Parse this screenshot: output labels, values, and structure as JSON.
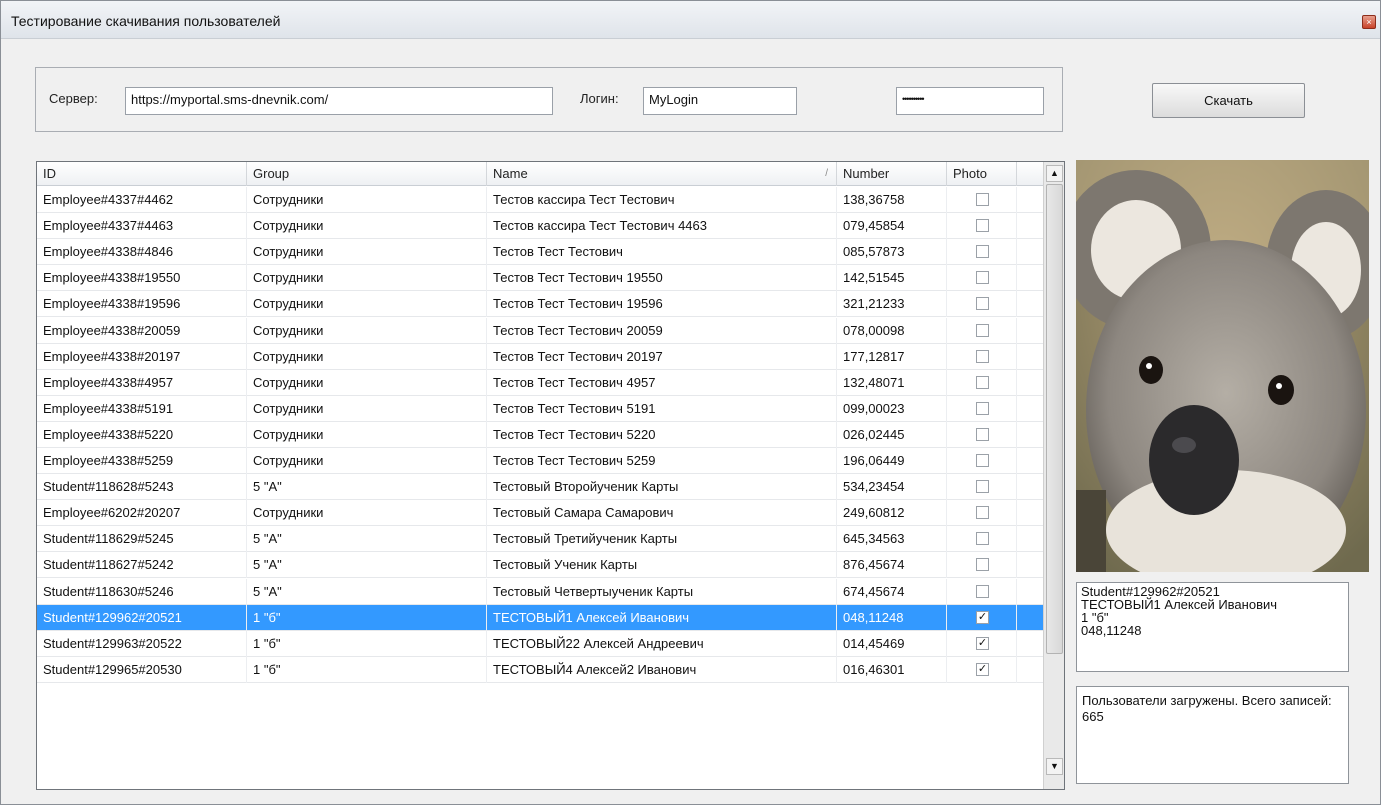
{
  "window": {
    "title": "Тестирование скачивания пользователей",
    "close_glyph": "×"
  },
  "connection": {
    "server_label": "Сервер:",
    "server_value": "https://myportal.sms-dnevnik.com/",
    "login_label": "Логин:",
    "login_value": "MyLogin",
    "password_value": "••••••••••"
  },
  "download_button": "Скачать",
  "grid": {
    "columns": [
      "ID",
      "Group",
      "Name",
      "Number",
      "Photo"
    ],
    "sort_column": "Name",
    "sort_glyph": "/",
    "rows": [
      {
        "id": "Employee#4337#4462",
        "group": "Сотрудники",
        "name": "Тестов кассира Тест Тестович",
        "number": "138,36758",
        "photo": false
      },
      {
        "id": "Employee#4337#4463",
        "group": "Сотрудники",
        "name": "Тестов кассира Тест Тестович 4463",
        "number": "079,45854",
        "photo": false
      },
      {
        "id": "Employee#4338#4846",
        "group": "Сотрудники",
        "name": "Тестов Тест Тестович",
        "number": "085,57873",
        "photo": false
      },
      {
        "id": "Employee#4338#19550",
        "group": "Сотрудники",
        "name": "Тестов Тест Тестович 19550",
        "number": "142,51545",
        "photo": false
      },
      {
        "id": "Employee#4338#19596",
        "group": "Сотрудники",
        "name": "Тестов Тест Тестович 19596",
        "number": "321,21233",
        "photo": false
      },
      {
        "id": "Employee#4338#20059",
        "group": "Сотрудники",
        "name": "Тестов Тест Тестович 20059",
        "number": "078,00098",
        "photo": false
      },
      {
        "id": "Employee#4338#20197",
        "group": "Сотрудники",
        "name": "Тестов Тест Тестович 20197",
        "number": "177,12817",
        "photo": false
      },
      {
        "id": "Employee#4338#4957",
        "group": "Сотрудники",
        "name": "Тестов Тест Тестович 4957",
        "number": "132,48071",
        "photo": false
      },
      {
        "id": "Employee#4338#5191",
        "group": "Сотрудники",
        "name": "Тестов Тест Тестович 5191",
        "number": "099,00023",
        "photo": false
      },
      {
        "id": "Employee#4338#5220",
        "group": "Сотрудники",
        "name": "Тестов Тест Тестович 5220",
        "number": "026,02445",
        "photo": false
      },
      {
        "id": "Employee#4338#5259",
        "group": "Сотрудники",
        "name": "Тестов Тест Тестович 5259",
        "number": "196,06449",
        "photo": false
      },
      {
        "id": "Student#118628#5243",
        "group": "5 \"А\"",
        "name": "Тестовый Второйученик Карты",
        "number": "534,23454",
        "photo": false
      },
      {
        "id": "Employee#6202#20207",
        "group": "Сотрудники",
        "name": "Тестовый Самара Самарович",
        "number": "249,60812",
        "photo": false
      },
      {
        "id": "Student#118629#5245",
        "group": "5 \"А\"",
        "name": "Тестовый Третийученик Карты",
        "number": "645,34563",
        "photo": false
      },
      {
        "id": "Student#118627#5242",
        "group": "5 \"А\"",
        "name": "Тестовый Ученик Карты",
        "number": "876,45674",
        "photo": false
      },
      {
        "id": "Student#118630#5246",
        "group": "5 \"А\"",
        "name": "Тестовый Четвертыученик Карты",
        "number": "674,45674",
        "photo": false
      },
      {
        "id": "Student#129962#20521",
        "group": "1 \"б\"",
        "name": "ТЕСТОВЫЙ1 Алексей Иванович",
        "number": "048,11248",
        "photo": true,
        "selected": true
      },
      {
        "id": "Student#129963#20522",
        "group": "1 \"б\"",
        "name": "ТЕСТОВЫЙ22 Алексей Андреевич",
        "number": "014,45469",
        "photo": true
      },
      {
        "id": "Student#129965#20530",
        "group": "1 \"б\"",
        "name": "ТЕСТОВЫЙ4 Алексей2 Иванович",
        "number": "016,46301",
        "photo": true
      }
    ]
  },
  "scrollbar": {
    "up_glyph": "▲",
    "down_glyph": "▼"
  },
  "selected_info": "Student#129962#20521\nТЕСТОВЫЙ1 Алексей Иванович\n1 \"б\"\n048,11248",
  "status": "Пользователи загружены. Всего записей: 665",
  "colors": {
    "selection": "#3399ff"
  }
}
